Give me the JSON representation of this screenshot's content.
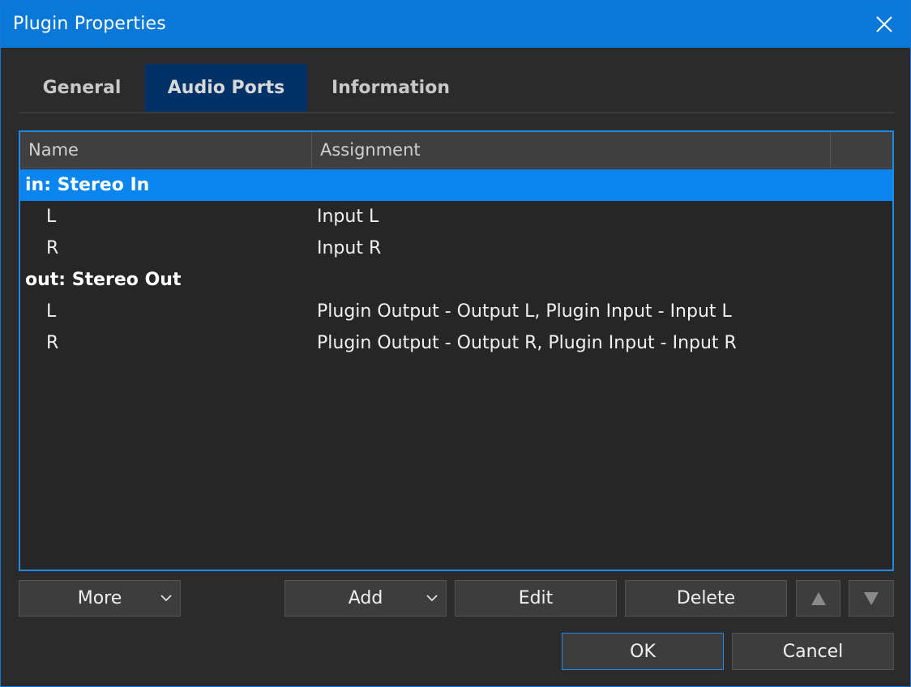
{
  "window": {
    "title": "Plugin Properties"
  },
  "tabs": [
    {
      "label": "General",
      "active": false
    },
    {
      "label": "Audio Ports",
      "active": true
    },
    {
      "label": "Information",
      "active": false
    }
  ],
  "table": {
    "columns": [
      "Name",
      "Assignment",
      ""
    ],
    "rows": [
      {
        "type": "group",
        "name": "in: Stereo In",
        "assignment": "",
        "selected": true
      },
      {
        "type": "port",
        "name": "L",
        "assignment": "Input L",
        "selected": false
      },
      {
        "type": "port",
        "name": "R",
        "assignment": "Input R",
        "selected": false
      },
      {
        "type": "group",
        "name": "out: Stereo Out",
        "assignment": "",
        "selected": false
      },
      {
        "type": "port",
        "name": "L",
        "assignment": "Plugin Output - Output L, Plugin Input - Input L",
        "selected": false
      },
      {
        "type": "port",
        "name": "R",
        "assignment": "Plugin Output - Output R, Plugin Input - Input R",
        "selected": false
      }
    ]
  },
  "buttons": {
    "more": "More",
    "add": "Add",
    "edit": "Edit",
    "delete": "Delete",
    "ok": "OK",
    "cancel": "Cancel"
  },
  "icons": {
    "close": "close-icon",
    "chevron": "chevron-down-icon",
    "up": "triangle-up-icon",
    "down": "triangle-down-icon"
  },
  "colors": {
    "titlebar": "#0a78d7",
    "selection": "#0a84ee",
    "active_tab": "#003268",
    "focus_border": "#1e8ae6"
  }
}
